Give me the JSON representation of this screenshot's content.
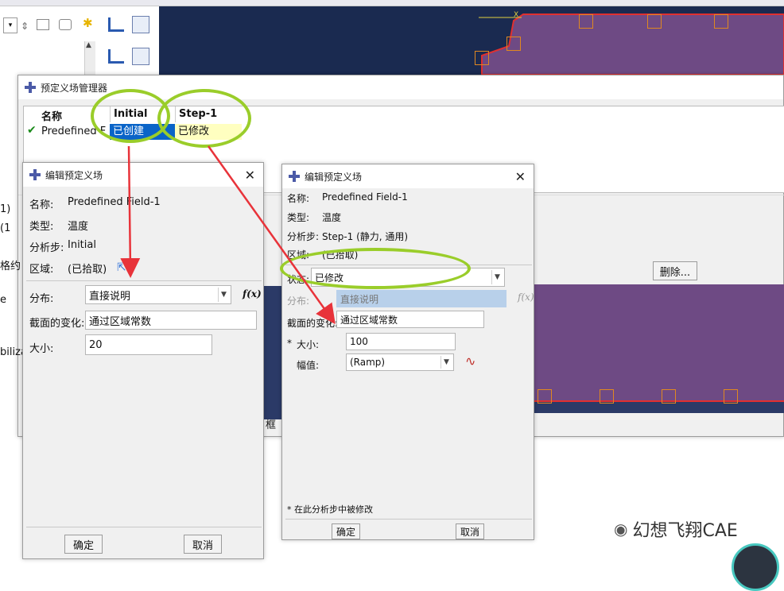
{
  "manager": {
    "title": "预定义场管理器",
    "columns": [
      "名称",
      "Initial",
      "Step-1"
    ],
    "row": {
      "name": "Predefined F",
      "initial": "已创建",
      "step1": "已修改"
    },
    "delete_label": "删除..."
  },
  "background": {
    "left_fragments": [
      "1)",
      "(1",
      "格约",
      "e",
      "biliza"
    ],
    "frame_label": "框"
  },
  "dialog_left": {
    "title": "编辑预定义场",
    "name_label": "名称:",
    "name_value": "Predefined Field-1",
    "type_label": "类型:",
    "type_value": "温度",
    "step_label": "分析步:",
    "step_value": "Initial",
    "region_label": "区域:",
    "region_value": "(已拾取)",
    "dist_label": "分布:",
    "dist_value": "直接说明",
    "section_label": "截面的变化:",
    "section_value": "通过区域常数",
    "mag_label": "大小:",
    "mag_value": "20",
    "fx": "f(x)",
    "ok": "确定",
    "cancel": "取消"
  },
  "dialog_right": {
    "title": "编辑预定义场",
    "name_label": "名称:",
    "name_value": "Predefined Field-1",
    "type_label": "类型:",
    "type_value": "温度",
    "step_label": "分析步:",
    "step_value": "Step-1 (静力, 通用)",
    "region_label": "区域:",
    "region_value": "(已拾取)",
    "status_label": "状态:",
    "status_value": "已修改",
    "dist_label": "分布:",
    "dist_value": "直接说明",
    "section_label": "截面的变化:",
    "section_value": "通过区域常数",
    "mag_label": "大小:",
    "mag_value": "100",
    "amp_label": "幅值:",
    "amp_value": "(Ramp)",
    "fx": "f(x)",
    "note": "* 在此分析步中被修改",
    "ok": "确定",
    "cancel": "取消"
  },
  "watermark": "幻想飞翔CAE",
  "colors": {
    "highlight_ellipse": "#9acd2a",
    "arrow": "#e8333a",
    "selected_cell": "#0a64c8",
    "modified_cell": "#ffffc0"
  }
}
